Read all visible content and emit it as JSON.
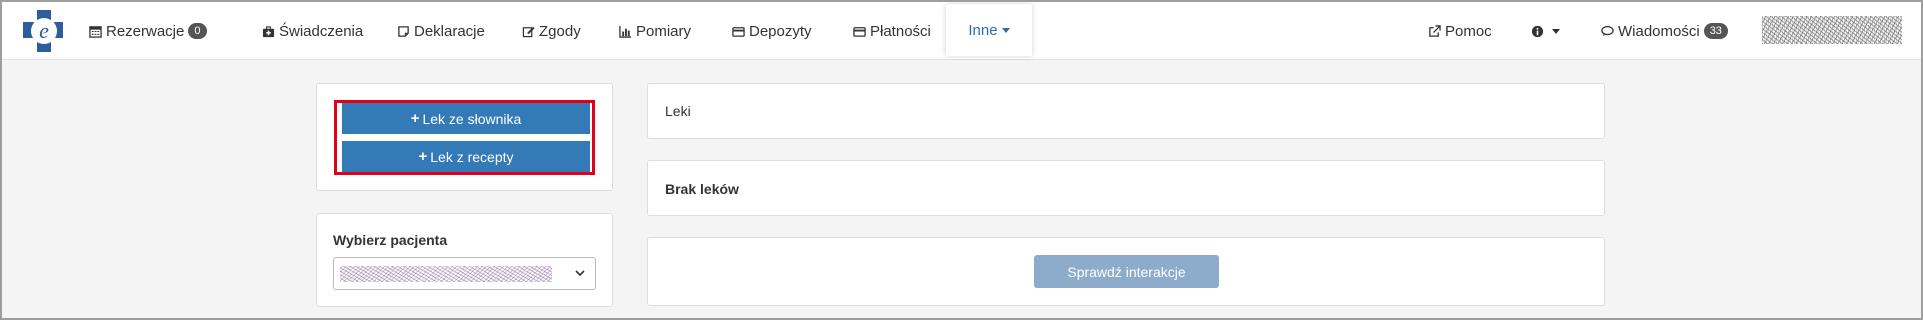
{
  "nav": {
    "rezerwacje": {
      "label": "Rezerwacje",
      "badge": "0"
    },
    "swiadczenia": {
      "label": "Świadczenia"
    },
    "deklaracje": {
      "label": "Deklaracje"
    },
    "zgody": {
      "label": "Zgody"
    },
    "pomiary": {
      "label": "Pomiary"
    },
    "depozyty": {
      "label": "Depozyty"
    },
    "platnosci": {
      "label": "Płatności"
    },
    "inne": {
      "label": "Inne"
    },
    "pomoc": {
      "label": "Pomoc"
    },
    "wiadomosci": {
      "label": "Wiadomości",
      "badge": "33"
    }
  },
  "actions": {
    "add_from_dictionary": "Lek ze słownika",
    "add_from_prescription": "Lek z recepty"
  },
  "patient": {
    "heading": "Wybierz pacjenta"
  },
  "medicines": {
    "heading": "Leki",
    "empty_text": "Brak leków",
    "check_button": "Sprawdź interakcje"
  },
  "colors": {
    "primary": "#337ab7",
    "primary_disabled": "#8daccb",
    "active_tab": "#2e6da4",
    "highlight": "#e0001b"
  }
}
